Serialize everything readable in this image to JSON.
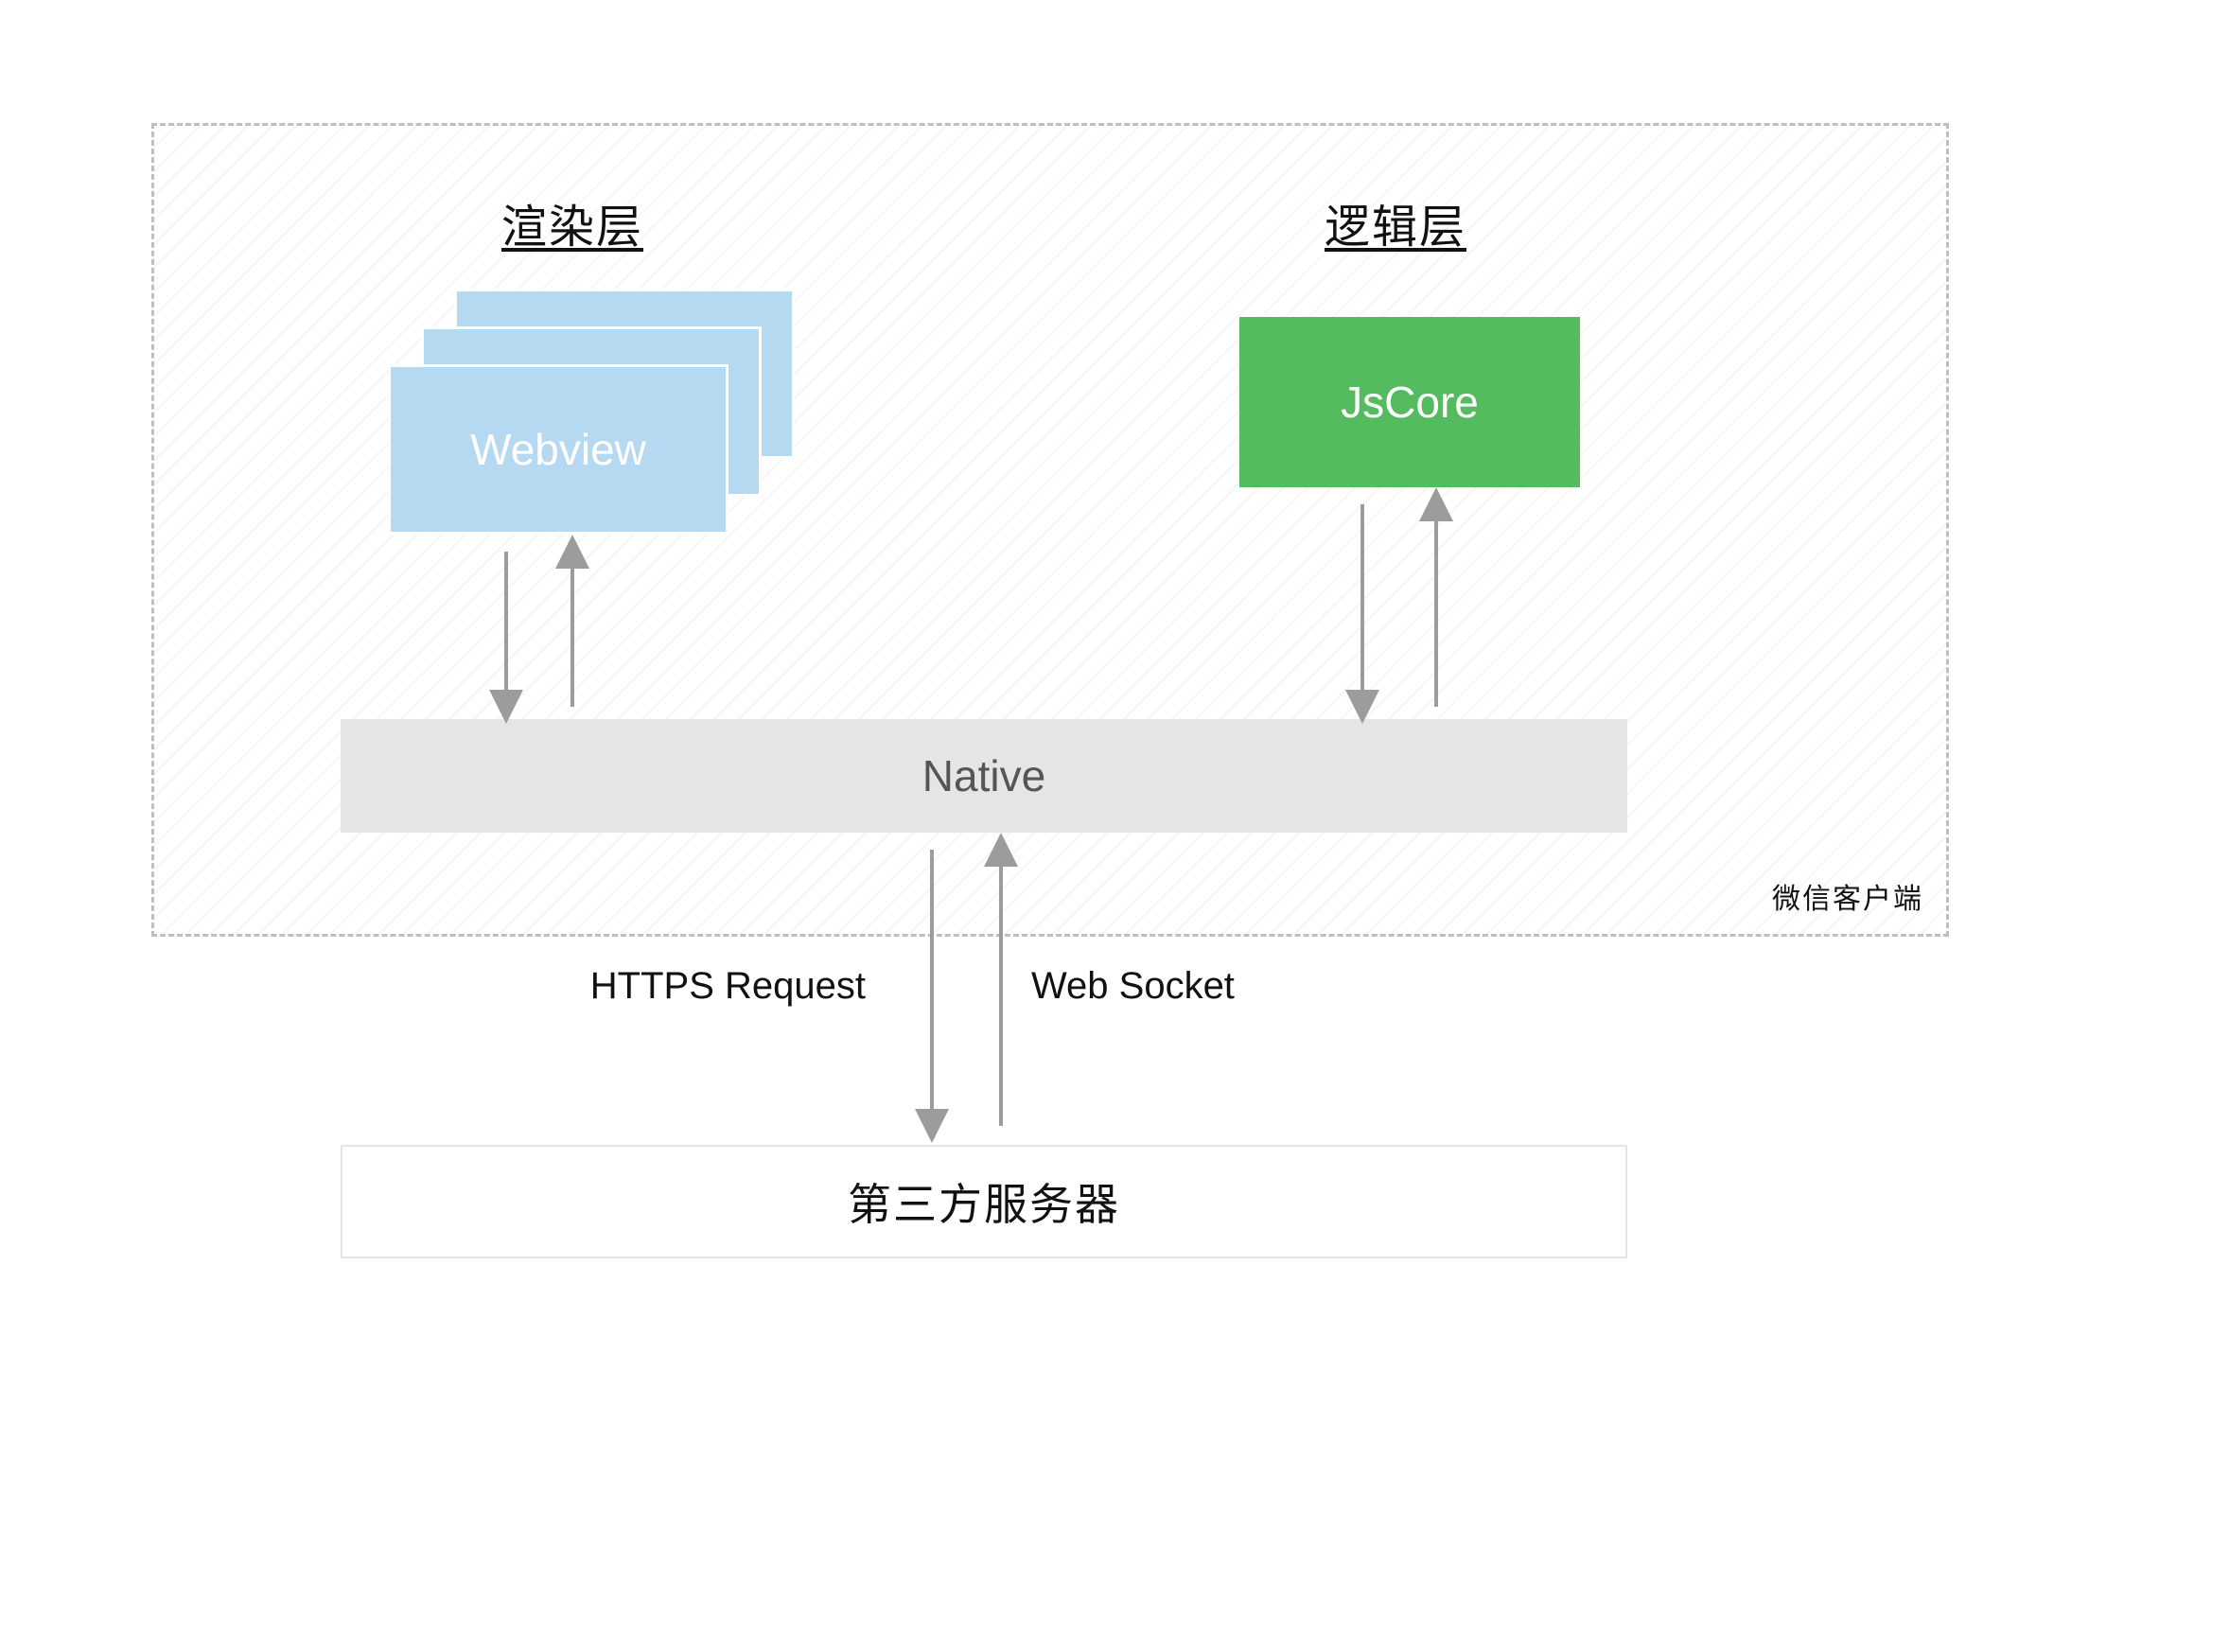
{
  "titles": {
    "render_layer": "渲染层",
    "logic_layer": "逻辑层"
  },
  "boxes": {
    "webview_label": "Webview",
    "jscore_label": "JsCore",
    "native_label": "Native",
    "server_label": "第三方服务器"
  },
  "client_caption": "微信客户端",
  "connections": {
    "https_label": "HTTPS Request",
    "ws_label": "Web Socket"
  },
  "colors": {
    "webview_bg": "#b6d9f2",
    "jscore_bg": "#54bb5f",
    "native_bg": "#e5e5e5",
    "arrow": "#9c9c9c",
    "dash_border": "#bfbfbf"
  }
}
